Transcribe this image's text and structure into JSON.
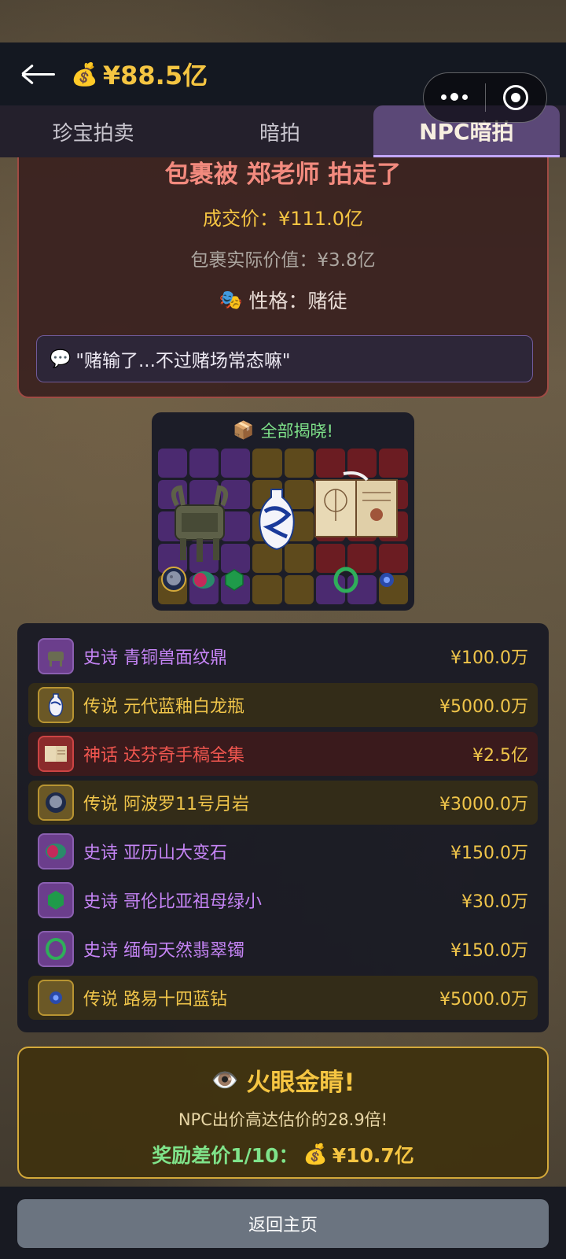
{
  "header": {
    "money_icon": "money-bag-icon",
    "money": "¥88.5亿"
  },
  "tabs": [
    {
      "label": "珍宝拍卖",
      "active": false
    },
    {
      "label": "暗拍",
      "active": false
    },
    {
      "label": "NPC暗拍",
      "active": true
    }
  ],
  "result": {
    "title": "包裹被 郑老师 拍走了",
    "deal_price": "成交价：¥111.0亿",
    "real_value": "包裹实际价值：¥3.8亿",
    "personality": "性格：赌徒",
    "quote": "\"赌输了...不过赌场常态嘛\""
  },
  "grid": {
    "header": "全部揭晓!"
  },
  "items": [
    {
      "rarity": "史诗",
      "name": "青铜兽面纹鼎",
      "price": "¥100.0万",
      "tier": "epic",
      "icon": "bronze-ding-icon"
    },
    {
      "rarity": "传说",
      "name": "元代蓝釉白龙瓶",
      "price": "¥5000.0万",
      "tier": "legend",
      "icon": "blue-vase-icon"
    },
    {
      "rarity": "神话",
      "name": "达芬奇手稿全集",
      "price": "¥2.5亿",
      "tier": "myth",
      "icon": "manuscript-icon"
    },
    {
      "rarity": "传说",
      "name": "阿波罗11号月岩",
      "price": "¥3000.0万",
      "tier": "legend",
      "icon": "moon-rock-icon"
    },
    {
      "rarity": "史诗",
      "name": "亚历山大变石",
      "price": "¥150.0万",
      "tier": "epic",
      "icon": "alexandrite-icon"
    },
    {
      "rarity": "史诗",
      "name": "哥伦比亚祖母绿小",
      "price": "¥30.0万",
      "tier": "epic",
      "icon": "emerald-icon"
    },
    {
      "rarity": "史诗",
      "name": "缅甸天然翡翠镯",
      "price": "¥150.0万",
      "tier": "epic",
      "icon": "jade-bangle-icon"
    },
    {
      "rarity": "传说",
      "name": "路易十四蓝钻",
      "price": "¥5000.0万",
      "tier": "legend",
      "icon": "blue-diamond-icon"
    }
  ],
  "bonus": {
    "title": "火眼金睛!",
    "description": "NPC出价高达估价的28.9倍!",
    "reward_label": "奖励差价1/10：",
    "reward_amount": "¥10.7亿"
  },
  "footer": {
    "home_label": "返回主页"
  },
  "colors": {
    "epic": "#c584f5",
    "legend": "#f0c54a",
    "myth": "#f0564f",
    "accent_gold": "#f5c542",
    "accent_green": "#7fe38a"
  }
}
